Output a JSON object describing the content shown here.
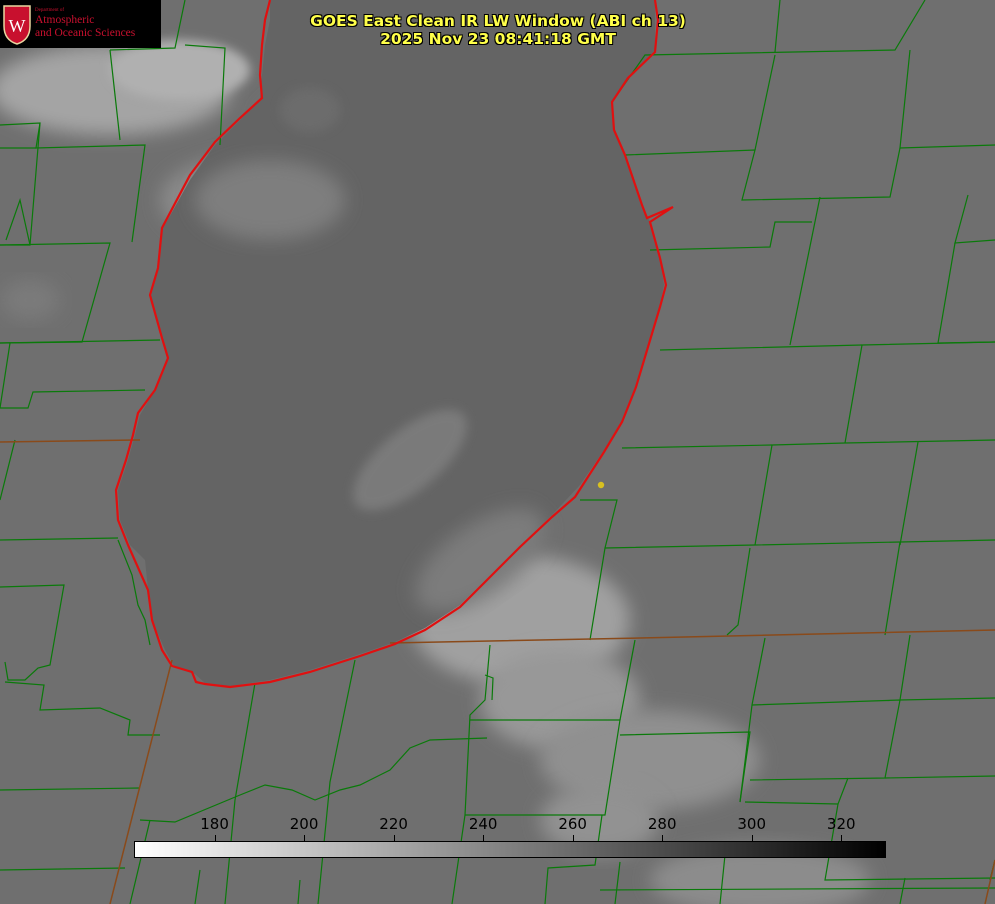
{
  "logo": {
    "department_text": "Department of",
    "line1": "Atmospheric",
    "line2": "and Oceanic Sciences",
    "crest_letter": "W",
    "crest_color": "#c8102e"
  },
  "title": {
    "line1": "GOES East Clean IR LW Window (ABI ch 13)",
    "line2": "2025 Nov 23 08:41:18 GMT",
    "color": "#ffff4a"
  },
  "map": {
    "boundary_color": "#0a7a0a",
    "coastline_color": "#e01010",
    "marker_color": "#d8c020",
    "marker_icon": "location-dot-icon"
  },
  "colorbar": {
    "ticks": [
      180,
      200,
      220,
      240,
      260,
      280,
      300,
      320
    ],
    "range": [
      162,
      330
    ],
    "gradient": [
      "#ffffff",
      "#000000"
    ]
  }
}
